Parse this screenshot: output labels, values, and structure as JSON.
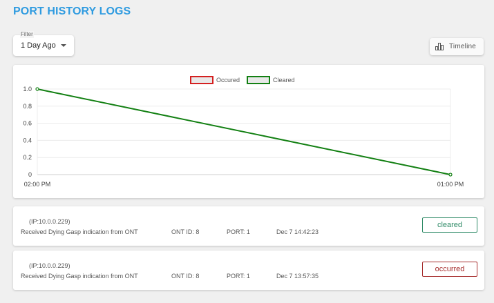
{
  "page": {
    "title": "PORT HISTORY LOGS"
  },
  "filter": {
    "label": "Filter",
    "value": "1 Day Ago"
  },
  "toolbar": {
    "timeline_label": "Timeline"
  },
  "colors": {
    "title": "#2f9be0",
    "occured": "#d42020",
    "cleared": "#138013",
    "legend_fill": "#e8e8e8"
  },
  "chart_data": {
    "type": "line",
    "x": [
      "02:00 PM",
      "01:00 PM"
    ],
    "series": [
      {
        "name": "Occured",
        "values": []
      },
      {
        "name": "Cleared",
        "values": [
          1.0,
          0
        ]
      }
    ],
    "ylim": [
      0,
      1.0
    ],
    "yticks": [
      "1.0",
      "0.8",
      "0.6",
      "0.4",
      "0.2",
      "0"
    ],
    "grid": true,
    "legend": "top-center"
  },
  "logs": [
    {
      "ip": "(IP:10.0.0.229)",
      "message": "Received Dying Gasp indication from ONT",
      "ont": "ONT ID: 8",
      "port": "PORT: 1",
      "date": "Dec 7 14:42:23",
      "status": "cleared"
    },
    {
      "ip": "(IP:10.0.0.229)",
      "message": "Received Dying Gasp indication from ONT",
      "ont": "ONT ID: 8",
      "port": "PORT: 1",
      "date": "Dec 7 13:57:35",
      "status": "occurred"
    }
  ]
}
